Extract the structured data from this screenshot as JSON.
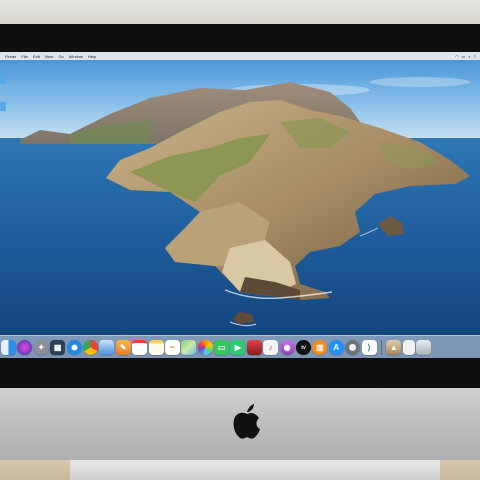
{
  "menubar": {
    "items": [
      "Finder",
      "File",
      "Edit",
      "View",
      "Go",
      "Window",
      "Help"
    ]
  },
  "desktop": {
    "wallpaper": "macOS Catalina island"
  },
  "dock": {
    "apps": [
      {
        "icon": "finder-icon",
        "color": "#2d8fe8"
      },
      {
        "icon": "siri-icon",
        "color": "#5b3fd1"
      },
      {
        "icon": "launchpad-icon",
        "color": "#8a8f99"
      },
      {
        "icon": "mission-control-icon",
        "color": "#3c4e63"
      },
      {
        "icon": "safari-icon",
        "color": "#1e88e5"
      },
      {
        "icon": "chrome-icon",
        "color": "#e94235"
      },
      {
        "icon": "preview-icon",
        "color": "#4a90d9"
      },
      {
        "icon": "pages-icon",
        "color": "#f39c2b"
      },
      {
        "icon": "calendar-icon",
        "color": "#ffffff"
      },
      {
        "icon": "notes-icon",
        "color": "#f7f3d6"
      },
      {
        "icon": "reminders-icon",
        "color": "#ffffff"
      },
      {
        "icon": "maps-icon",
        "color": "#6cc070"
      },
      {
        "icon": "photos-icon",
        "color": "#f5f5f5"
      },
      {
        "icon": "messages-icon",
        "color": "#34c759"
      },
      {
        "icon": "facetime-icon",
        "color": "#2ecc71"
      },
      {
        "icon": "photo-booth-icon",
        "color": "#c0392b"
      },
      {
        "icon": "music-icon",
        "color": "#fc3c44"
      },
      {
        "icon": "podcasts-icon",
        "color": "#9b59b6"
      },
      {
        "icon": "tv-icon",
        "color": "#111111"
      },
      {
        "icon": "books-icon",
        "color": "#ff8c1a"
      },
      {
        "icon": "app-store-icon",
        "color": "#1e90ff"
      },
      {
        "icon": "system-preferences-icon",
        "color": "#7f8c8d"
      },
      {
        "icon": "vscode-icon",
        "color": "#1f7acc"
      }
    ],
    "trailing": [
      {
        "icon": "installer-icon",
        "color": "#c9b08a"
      },
      {
        "icon": "document-icon",
        "color": "#f2f2f2"
      },
      {
        "icon": "trash-icon",
        "color": "#b8c4cc"
      }
    ]
  }
}
